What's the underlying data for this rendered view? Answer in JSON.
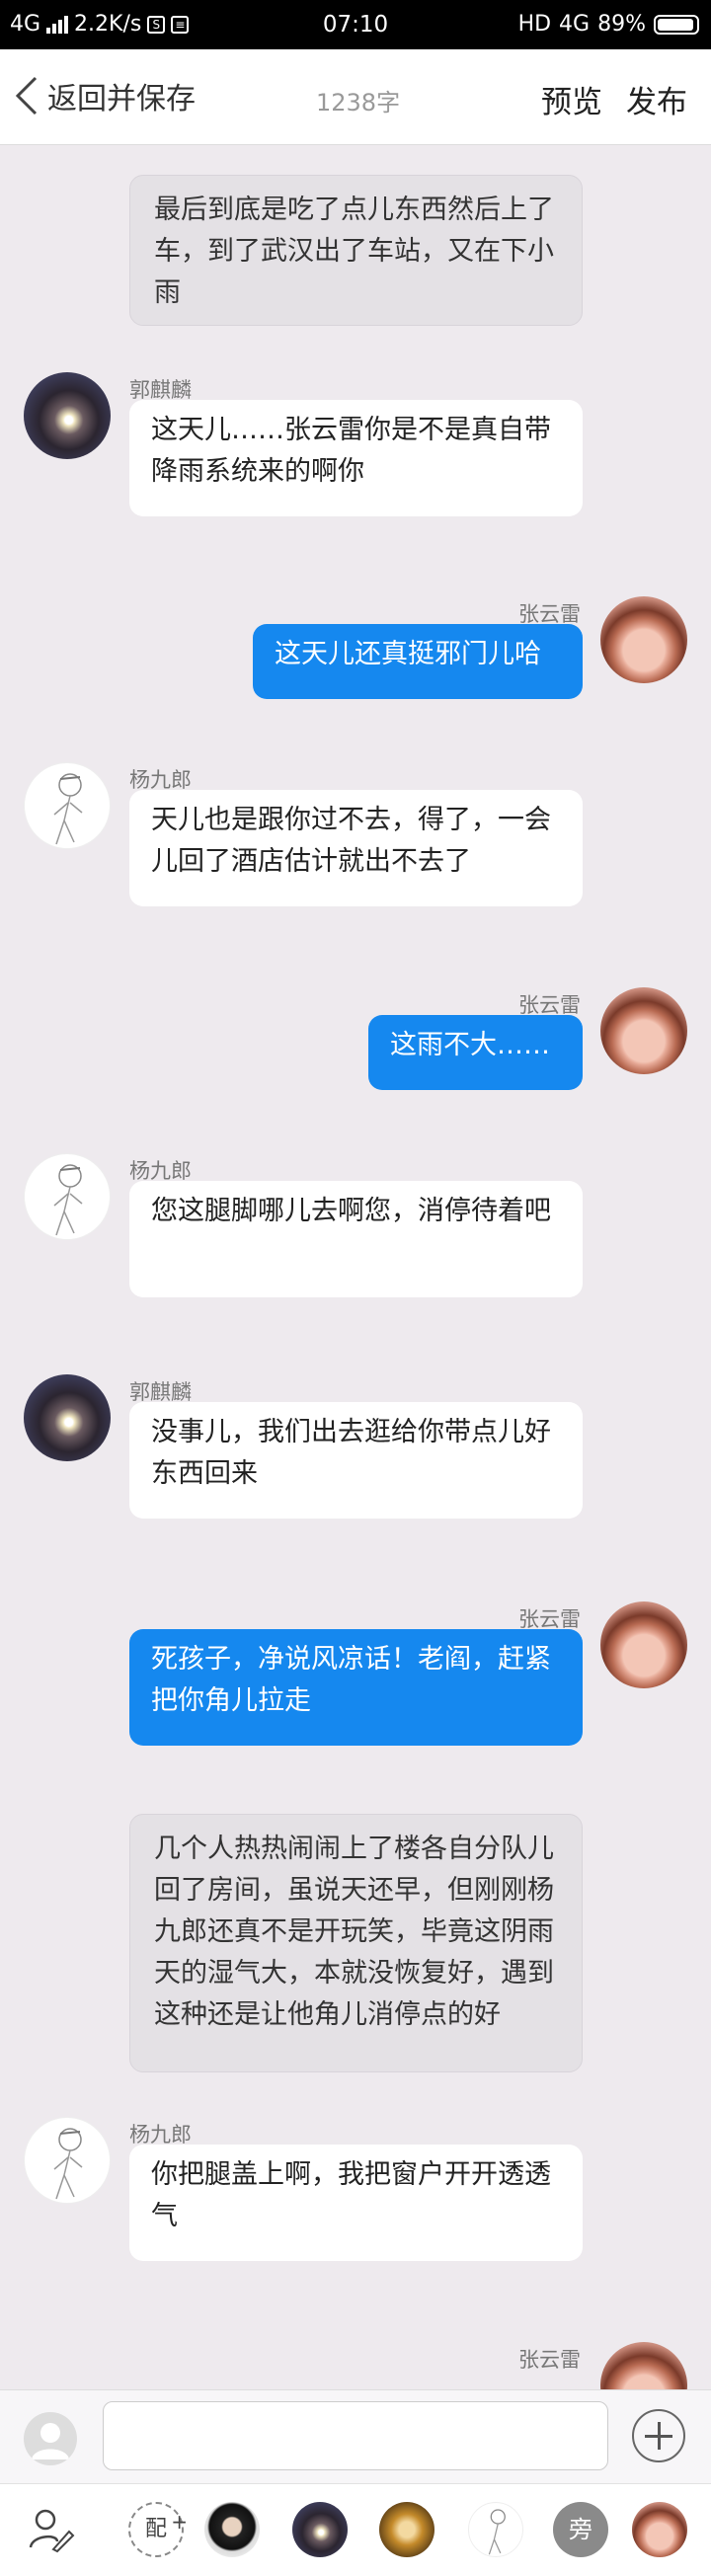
{
  "status_bar": {
    "network": "4G",
    "speed": "2.2K/s",
    "time": "07:10",
    "hd": "HD",
    "network_right": "4G",
    "battery": "89%"
  },
  "header": {
    "back_label": "返回并保存",
    "word_count": "1238字",
    "preview_label": "预览",
    "publish_label": "发布"
  },
  "messages": [
    {
      "type": "narration",
      "text": "最后到底是吃了点儿东西然后上了车，到了武汉出了车站，又在下小雨"
    },
    {
      "type": "other",
      "name": "郭麒麟",
      "avatar": "guo",
      "text": "这天儿……张云雷你是不是真自带降雨系统来的啊你"
    },
    {
      "type": "mine",
      "name": "张云雷",
      "avatar": "zhang",
      "text": "这天儿还真挺邪门儿哈"
    },
    {
      "type": "other",
      "name": "杨九郎",
      "avatar": "yang",
      "text": "天儿也是跟你过不去，得了，一会儿回了酒店估计就出不去了"
    },
    {
      "type": "mine",
      "name": "张云雷",
      "avatar": "zhang",
      "text": "这雨不大……"
    },
    {
      "type": "other",
      "name": "杨九郎",
      "avatar": "yang",
      "text": "您这腿脚哪儿去啊您，消停待着吧"
    },
    {
      "type": "other",
      "name": "郭麒麟",
      "avatar": "guo",
      "text": "没事儿，我们出去逛给你带点儿好东西回来"
    },
    {
      "type": "mine",
      "name": "张云雷",
      "avatar": "zhang",
      "text": "死孩子，净说风凉话！老阎，赶紧把你角儿拉走"
    },
    {
      "type": "narration",
      "text": "几个人热热闹闹上了楼各自分队儿回了房间，虽说天还早，但刚刚杨九郎还真不是开玩笑，毕竟这阴雨天的湿气大，本就没恢复好，遇到这种还是让他角儿消停点的好"
    },
    {
      "type": "other",
      "name": "杨九郎",
      "avatar": "yang",
      "text": "你把腿盖上啊，我把窗户开开透透气"
    },
    {
      "type": "mine",
      "name": "张云雷",
      "avatar": "zhang",
      "text": ""
    }
  ],
  "input": {
    "placeholder": ""
  },
  "character_bar": {
    "dub_label": "配",
    "narrator_label": "旁"
  }
}
